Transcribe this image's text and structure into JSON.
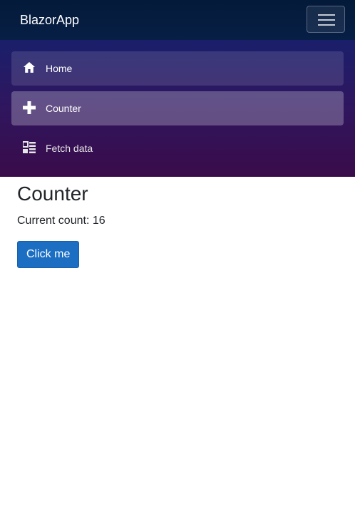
{
  "app": {
    "brand": "BlazorApp"
  },
  "nav": {
    "items": [
      {
        "label": "Home",
        "icon": "home-icon",
        "active": false
      },
      {
        "label": "Counter",
        "icon": "plus-icon",
        "active": true
      },
      {
        "label": "Fetch data",
        "icon": "list-icon",
        "active": false
      }
    ]
  },
  "page": {
    "title": "Counter",
    "count_label": "Current count: ",
    "count_value": "16",
    "button_label": "Click me"
  },
  "colors": {
    "top_bar": "#051e3e",
    "sidebar_start": "#1a1f6b",
    "sidebar_end": "#3a0b4a",
    "button": "#1b6ec2"
  }
}
